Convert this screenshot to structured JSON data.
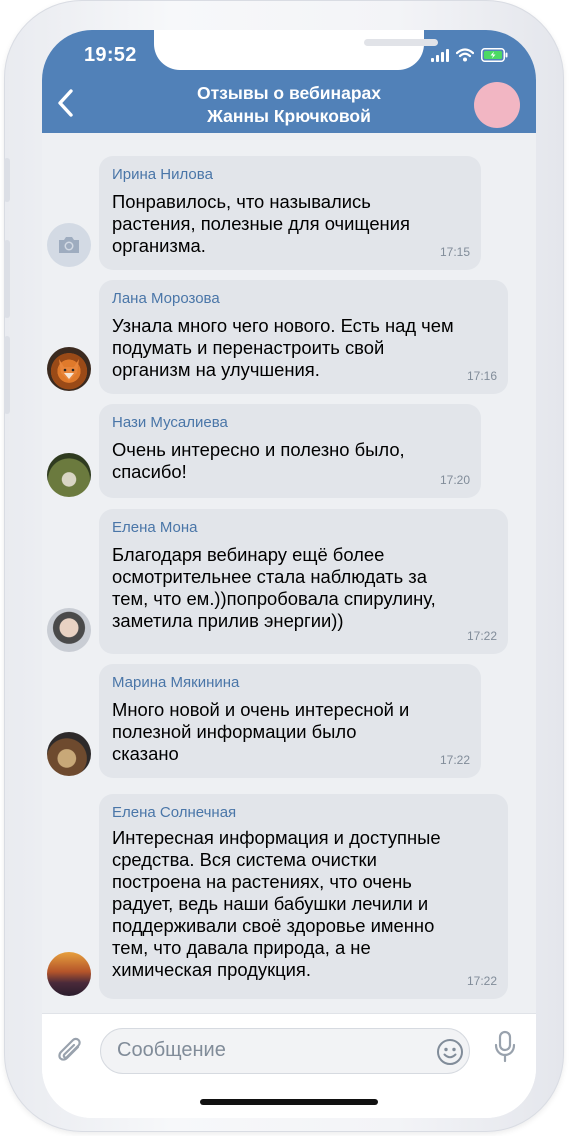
{
  "status_bar": {
    "time": "19:52"
  },
  "header": {
    "title_line1": "Отзывы о вебинарах",
    "title_line2": "Жанны Крючковой"
  },
  "messages": [
    {
      "author": "Ирина Нилова",
      "text": "Понравилось, что назывались\nрастения, полезные для очищения\nорганизма.",
      "time": "17:15",
      "avatar": "camera-placeholder"
    },
    {
      "author": "Лана Морозова",
      "text": "Узнала много чего нового. Есть над чем\nподумать и перенастроить свой\nорганизм на улучшения.",
      "time": "17:16",
      "avatar": "fox-photo"
    },
    {
      "author": "Нази Мусалиева",
      "text": "Очень интересно и полезно было,\nспасибо!",
      "time": "17:20",
      "avatar": "person-outdoors-photo"
    },
    {
      "author": "Елена Мона",
      "text": "Благодаря вебинару ещё более\nосмотрительнее стала наблюдать за\nтем, что ем.))попробовала спирулину,\nзаметила прилив энергии))",
      "time": "17:22",
      "avatar": "woman-portrait-photo"
    },
    {
      "author": "Марина Мякинина",
      "text": "Много новой и очень интересной и\nполезной информации было\nсказано",
      "time": "17:22",
      "avatar": "woman-with-teddy-photo"
    },
    {
      "author": "Елена Солнечная",
      "text": "Интересная информация и доступные\nсредства. Вся система очистки\nпостроена на растениях, что очень\nрадует, ведь наши бабушки лечили и\nподдерживали своё здоровье именно\nтем, что давала природа, а не\nхимическая продукция.",
      "time": "17:22",
      "avatar": "sunset-photo"
    }
  ],
  "composer": {
    "placeholder": "Сообщение"
  },
  "colors": {
    "header": "#5181b8",
    "bubble": "#e2e5ea",
    "author": "#4a76a8",
    "chat_bg": "#eef0f3"
  }
}
